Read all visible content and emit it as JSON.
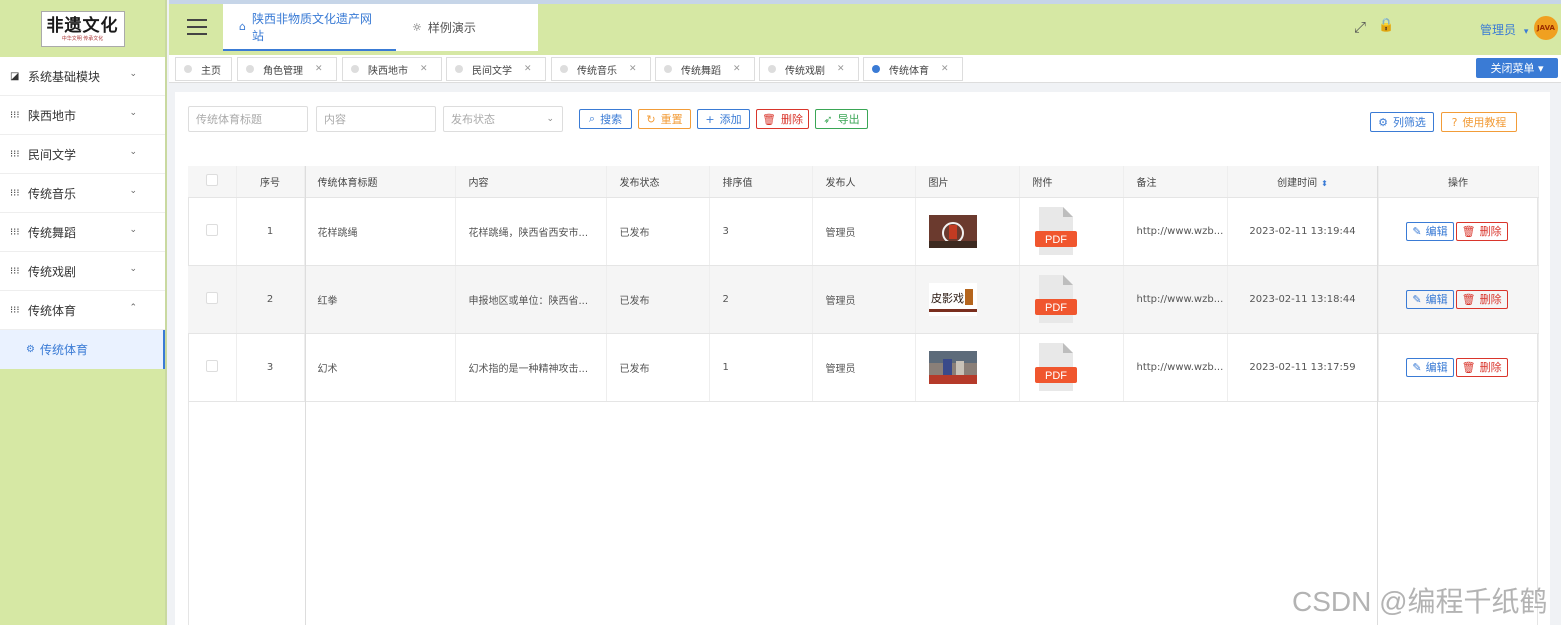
{
  "logo": {
    "main": "非遗文化",
    "sub": "中华文明 传承文化"
  },
  "sidebar": {
    "items": [
      {
        "label": "系统基础模块",
        "icon": "chart-icon",
        "glyph": "◪",
        "arrow": "⌄"
      },
      {
        "label": "陕西地市",
        "icon": "grid-icon",
        "glyph": "⁝⁝⁝",
        "arrow": "⌄"
      },
      {
        "label": "民间文学",
        "icon": "grid-icon",
        "glyph": "⁝⁝⁝",
        "arrow": "⌄"
      },
      {
        "label": "传统音乐",
        "icon": "grid-icon",
        "glyph": "⁝⁝⁝",
        "arrow": "⌄"
      },
      {
        "label": "传统舞蹈",
        "icon": "grid-icon",
        "glyph": "⁝⁝⁝",
        "arrow": "⌄"
      },
      {
        "label": "传统戏剧",
        "icon": "grid-icon",
        "glyph": "⁝⁝⁝",
        "arrow": "⌄"
      },
      {
        "label": "传统体育",
        "icon": "grid-icon",
        "glyph": "⁝⁝⁝",
        "arrow": "⌃"
      }
    ],
    "sub_item": {
      "label": "传统体育",
      "icon": "gear-icon",
      "glyph": "⚙"
    }
  },
  "header": {
    "tab_home": {
      "label": "陕西非物质文化遗产网站",
      "glyph": "⌂"
    },
    "tab_demo": {
      "label": "样例演示",
      "glyph": "☼"
    },
    "fullscreen_glyph": "⤢",
    "lock_glyph": "🔒",
    "admin_label": "管理员",
    "admin_caret": "▾",
    "avatar_text": "JAVA"
  },
  "tags": [
    {
      "label": "主页",
      "closable": false
    },
    {
      "label": "角色管理",
      "closable": true
    },
    {
      "label": "陕西地市",
      "closable": true
    },
    {
      "label": "民间文学",
      "closable": true
    },
    {
      "label": "传统音乐",
      "closable": true
    },
    {
      "label": "传统舞蹈",
      "closable": true
    },
    {
      "label": "传统戏剧",
      "closable": true
    },
    {
      "label": "传统体育",
      "closable": true,
      "active": true
    }
  ],
  "tag_close_glyph": "✕",
  "close_menu_label": "关闭菜单 ▾",
  "search": {
    "title_placeholder": "传统体育标题",
    "content_placeholder": "内容",
    "status_placeholder": "发布状态",
    "status_caret": "⌄"
  },
  "toolbar": {
    "search": "搜索",
    "search_glyph": "⌕",
    "reset": "重置",
    "reset_glyph": "↻",
    "add": "添加",
    "add_glyph": "+",
    "delete": "删除",
    "delete_glyph": "🗑",
    "export": "导出",
    "export_glyph": "➶",
    "column_filter": "列筛选",
    "column_filter_glyph": "⚙",
    "tutorial": "使用教程",
    "tutorial_glyph": "?"
  },
  "table": {
    "columns": [
      "序号",
      "传统体育标题",
      "内容",
      "发布状态",
      "排序值",
      "发布人",
      "图片",
      "附件",
      "备注",
      "创建时间",
      "操作"
    ],
    "sort_glyph": "⬍",
    "rows": [
      {
        "index": "1",
        "title": "花样跳绳",
        "content": "花样跳绳，陕西省西安市...",
        "status": "已发布",
        "sort": "3",
        "publisher": "管理员",
        "remark": "http://www.wzb...",
        "created": "2023-02-11 13:19:44"
      },
      {
        "index": "2",
        "title": "红拳",
        "content": "申报地区或单位：陕西省...",
        "status": "已发布",
        "sort": "2",
        "publisher": "管理员",
        "remark": "http://www.wzb...",
        "created": "2023-02-11 13:18:44"
      },
      {
        "index": "3",
        "title": "幻术",
        "content": "幻术指的是一种精神攻击...",
        "status": "已发布",
        "sort": "1",
        "publisher": "管理员",
        "remark": "http://www.wzb...",
        "created": "2023-02-11 13:17:59"
      }
    ],
    "edit_label": "编辑",
    "edit_glyph": "✎",
    "delete_label": "删除",
    "delete_glyph": "🗑",
    "pdf_label": "PDF",
    "thumb2_text": "皮影戏"
  },
  "watermark": "CSDN @编程千纸鹤"
}
